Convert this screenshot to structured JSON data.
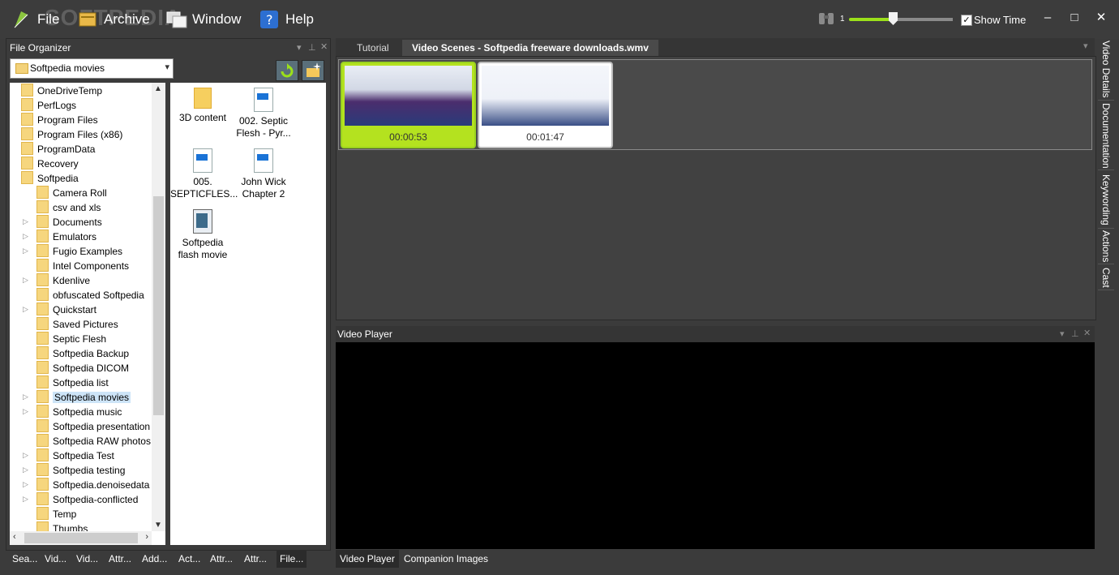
{
  "menu": {
    "file": "File",
    "archive": "Archive",
    "window": "Window",
    "help": "Help"
  },
  "watermark": "SOFTPEDIA",
  "toolbar": {
    "zoom_value": "1",
    "zoom_level": 0.42,
    "show_time_label": "Show Time",
    "show_time_checked": true
  },
  "window_controls": {
    "minimize": "–",
    "maximize": "□",
    "close": "✕"
  },
  "file_organizer": {
    "title": "File Organizer",
    "path_value": "Softpedia movies",
    "tree": [
      {
        "label": "OneDriveTemp",
        "level": 0,
        "expandable": false
      },
      {
        "label": "PerfLogs",
        "level": 0,
        "expandable": false
      },
      {
        "label": "Program Files",
        "level": 0,
        "expandable": false
      },
      {
        "label": "Program Files (x86)",
        "level": 0,
        "expandable": false
      },
      {
        "label": "ProgramData",
        "level": 0,
        "expandable": false
      },
      {
        "label": "Recovery",
        "level": 0,
        "expandable": false
      },
      {
        "label": "Softpedia",
        "level": 0,
        "expandable": false
      },
      {
        "label": "Camera Roll",
        "level": 1,
        "expandable": false
      },
      {
        "label": "csv and xls",
        "level": 1,
        "expandable": false
      },
      {
        "label": "Documents",
        "level": 1,
        "expandable": true
      },
      {
        "label": "Emulators",
        "level": 1,
        "expandable": true
      },
      {
        "label": "Fugio Examples",
        "level": 1,
        "expandable": true
      },
      {
        "label": "Intel Components",
        "level": 1,
        "expandable": false
      },
      {
        "label": "Kdenlive",
        "level": 1,
        "expandable": true
      },
      {
        "label": "obfuscated Softpedia",
        "level": 1,
        "expandable": false
      },
      {
        "label": "Quickstart",
        "level": 1,
        "expandable": true
      },
      {
        "label": "Saved Pictures",
        "level": 1,
        "expandable": false
      },
      {
        "label": "Septic Flesh",
        "level": 1,
        "expandable": false
      },
      {
        "label": "Softpedia Backup",
        "level": 1,
        "expandable": false
      },
      {
        "label": "Softpedia DICOM",
        "level": 1,
        "expandable": false
      },
      {
        "label": "Softpedia list",
        "level": 1,
        "expandable": false
      },
      {
        "label": "Softpedia movies",
        "level": 1,
        "expandable": true,
        "selected": true
      },
      {
        "label": "Softpedia music",
        "level": 1,
        "expandable": true
      },
      {
        "label": "Softpedia presentation",
        "level": 1,
        "expandable": false
      },
      {
        "label": "Softpedia RAW photos",
        "level": 1,
        "expandable": false
      },
      {
        "label": "Softpedia Test",
        "level": 1,
        "expandable": true
      },
      {
        "label": "Softpedia testing",
        "level": 1,
        "expandable": true
      },
      {
        "label": "Softpedia.denoisedata",
        "level": 1,
        "expandable": true
      },
      {
        "label": "Softpedia-conflicted",
        "level": 1,
        "expandable": true
      },
      {
        "label": "Temp",
        "level": 1,
        "expandable": false
      },
      {
        "label": "Thumbs",
        "level": 1,
        "expandable": false
      }
    ],
    "files": [
      {
        "line1": "3D content",
        "line2": "",
        "icon": "folder-icon"
      },
      {
        "line1": "002. Septic",
        "line2": "Flesh - Pyr...",
        "icon": "video-file-icon"
      },
      {
        "line1": "005.",
        "line2": "SEPTICFLES...",
        "icon": "video-file-icon"
      },
      {
        "line1": "John Wick",
        "line2": "Chapter 2",
        "icon": "video-file-icon"
      },
      {
        "line1": "Softpedia",
        "line2": "flash movie",
        "icon": "film-file-icon"
      }
    ]
  },
  "left_tabs": [
    "Sea...",
    "Vid...",
    "Vid...",
    "Attr...",
    "Add...",
    "Act...",
    "Attr...",
    "Attr...",
    "File..."
  ],
  "doc_tabs": {
    "tutorial": "Tutorial",
    "scenes": "Video Scenes - Softpedia freeware downloads.wmv"
  },
  "scenes": [
    {
      "time": "00:00:53",
      "selected": true
    },
    {
      "time": "00:01:47",
      "selected": false
    }
  ],
  "side_tabs": [
    "Video Details",
    "Documentation",
    "Keywording",
    "Actions",
    "Cast"
  ],
  "video_player": {
    "title": "Video Player"
  },
  "bottom_tabs": {
    "player": "Video Player",
    "companion": "Companion Images"
  },
  "colors": {
    "accent": "#9be01a",
    "panel": "#3b3b3b",
    "selection": "#cde4f7"
  }
}
